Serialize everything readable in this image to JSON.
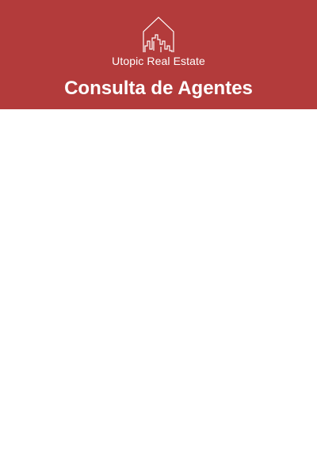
{
  "brand": {
    "name": "Utopic Real Estate",
    "logo_icon": "house-city-skyline-icon"
  },
  "header": {
    "title": "Consulta de Agentes"
  },
  "colors": {
    "header_bg": "#b33b3b",
    "header_text": "#ffffff",
    "page_bg": "#ffffff"
  }
}
